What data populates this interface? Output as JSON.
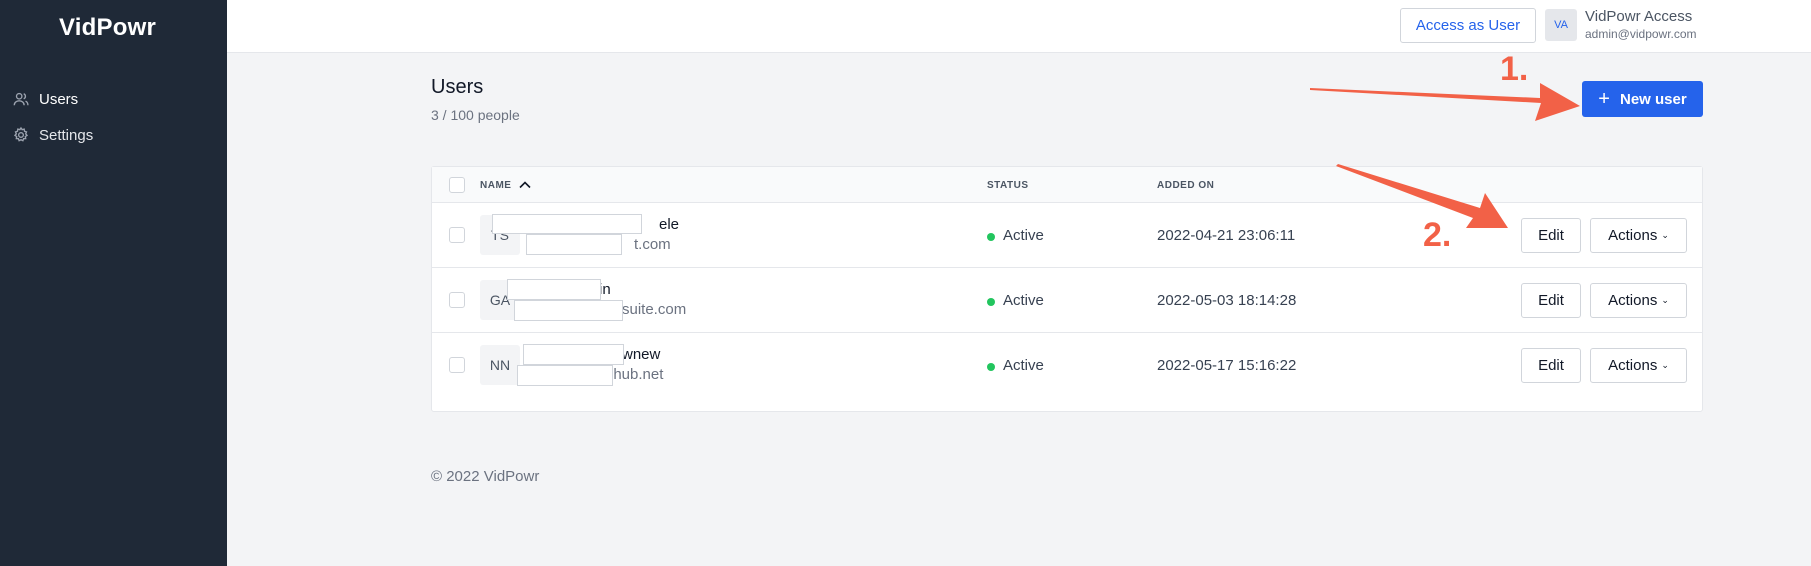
{
  "sidebar": {
    "logo": "VidPowr",
    "items": [
      {
        "label": "Users",
        "icon": "users-icon"
      },
      {
        "label": "Settings",
        "icon": "gear-icon"
      }
    ]
  },
  "topbar": {
    "access_button": "Access as User",
    "avatar_initials": "VA",
    "user_name": "VidPowr Access",
    "user_email": "admin@vidpowr.com"
  },
  "page": {
    "title": "Users",
    "subtitle": "3 / 100 people",
    "new_user_button": "New user"
  },
  "table": {
    "columns": {
      "name": "NAME",
      "status": "STATUS",
      "added_on": "ADDED ON"
    },
    "sort_icon": "chevron-up-icon",
    "rows": [
      {
        "initials": "TS",
        "name_visible": "ele",
        "email_visible": "t.com",
        "status": "Active",
        "added_on": "2022-04-21 23:06:11",
        "edit": "Edit",
        "actions": "Actions"
      },
      {
        "initials": "GA",
        "name_visible": "in",
        "email_visible": "suite.com",
        "status": "Active",
        "added_on": "2022-05-03 18:14:28",
        "edit": "Edit",
        "actions": "Actions"
      },
      {
        "initials": "NN",
        "name_visible": "wnew",
        "email_visible": "ihub.net",
        "status": "Active",
        "added_on": "2022-05-17 15:16:22",
        "edit": "Edit",
        "actions": "Actions"
      }
    ]
  },
  "footer": "© 2022 VidPowr",
  "annotations": {
    "label_1": "1.",
    "label_2": "2.",
    "arrow_color": "#f26147"
  },
  "colors": {
    "sidebar_bg": "#1f2937",
    "primary": "#2563eb",
    "status_active": "#22c55e"
  }
}
